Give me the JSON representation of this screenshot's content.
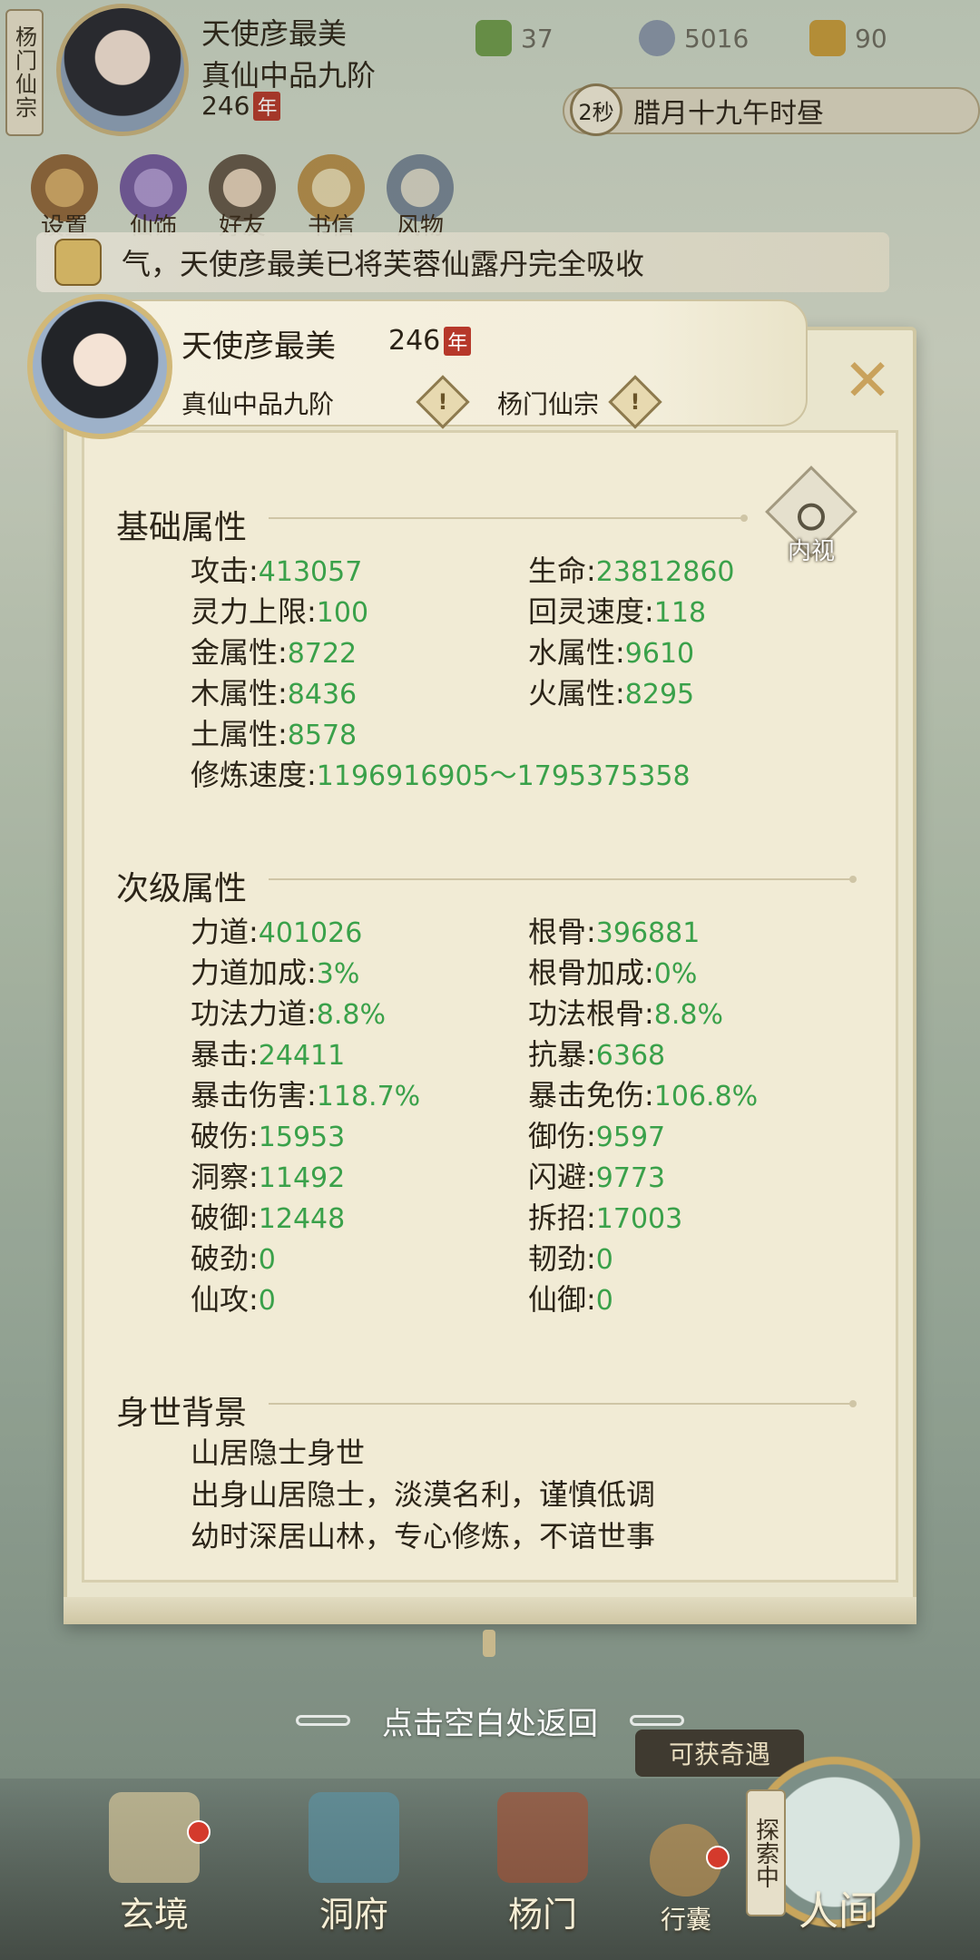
{
  "hud": {
    "sect_tag": "杨门仙宗",
    "player_name": "天使彦最美",
    "player_rank": "真仙中品九阶",
    "player_age": "246",
    "age_unit": "年",
    "resources": [
      {
        "icon": "jade-leaf-icon",
        "value": "37"
      },
      {
        "icon": "coin-icon",
        "value": "5016"
      },
      {
        "icon": "gold-ingot-icon",
        "value": "90"
      }
    ],
    "timer_seconds": "2秒",
    "calendar_time": "腊月十九午时昼",
    "menu": [
      "设置",
      "仙饰",
      "好友",
      "书信",
      "风物"
    ],
    "news_text": "气，天使彦最美已将芙蓉仙露丹完全吸收"
  },
  "header": {
    "name": "天使彦最美",
    "age": "246",
    "age_unit": "年",
    "rank": "真仙中品九阶",
    "sect": "杨门仙宗",
    "close_icon": "close-x-icon"
  },
  "neishi_label": "内视",
  "basic": {
    "title": "基础属性",
    "left": [
      {
        "label": "攻击",
        "value": "413057"
      },
      {
        "label": "灵力上限",
        "value": "100"
      },
      {
        "label": "金属性",
        "value": "8722"
      },
      {
        "label": "木属性",
        "value": "8436"
      },
      {
        "label": "土属性",
        "value": "8578"
      },
      {
        "label": "修炼速度",
        "value": "1196916905～1795375358"
      }
    ],
    "right": [
      {
        "label": "生命",
        "value": "23812860"
      },
      {
        "label": "回灵速度",
        "value": "118"
      },
      {
        "label": "水属性",
        "value": "9610"
      },
      {
        "label": "火属性",
        "value": "8295"
      }
    ]
  },
  "secondary": {
    "title": "次级属性",
    "left": [
      {
        "label": "力道",
        "value": "401026"
      },
      {
        "label": "力道加成",
        "value": "3%"
      },
      {
        "label": "功法力道",
        "value": "8.8%"
      },
      {
        "label": "暴击",
        "value": "24411"
      },
      {
        "label": "暴击伤害",
        "value": "118.7%"
      },
      {
        "label": "破伤",
        "value": "15953"
      },
      {
        "label": "洞察",
        "value": "11492"
      },
      {
        "label": "破御",
        "value": "12448"
      },
      {
        "label": "破劲",
        "value": "0"
      },
      {
        "label": "仙攻",
        "value": "0"
      }
    ],
    "right": [
      {
        "label": "根骨",
        "value": "396881"
      },
      {
        "label": "根骨加成",
        "value": "0%"
      },
      {
        "label": "功法根骨",
        "value": "8.8%"
      },
      {
        "label": "抗暴",
        "value": "6368"
      },
      {
        "label": "暴击免伤",
        "value": "106.8%"
      },
      {
        "label": "御伤",
        "value": "9597"
      },
      {
        "label": "闪避",
        "value": "9773"
      },
      {
        "label": "拆招",
        "value": "17003"
      },
      {
        "label": "韧劲",
        "value": "0"
      },
      {
        "label": "仙御",
        "value": "0"
      }
    ]
  },
  "background": {
    "title": "身世背景",
    "lines": [
      "山居隐士身世",
      "出身山居隐士，淡漠名利，谨慎低调",
      "幼时深居山林，专心修炼，不谙世事"
    ]
  },
  "hint": "点击空白处返回",
  "encounter_label": "可获奇遇",
  "explore_label": "探索中",
  "bottom_nav": [
    "玄境",
    "洞府",
    "杨门",
    "行囊",
    "人间"
  ],
  "colors": {
    "value_green": "#3aa14a",
    "panel_bg": "#f1ebd5",
    "age_badge": "#b6382a"
  }
}
